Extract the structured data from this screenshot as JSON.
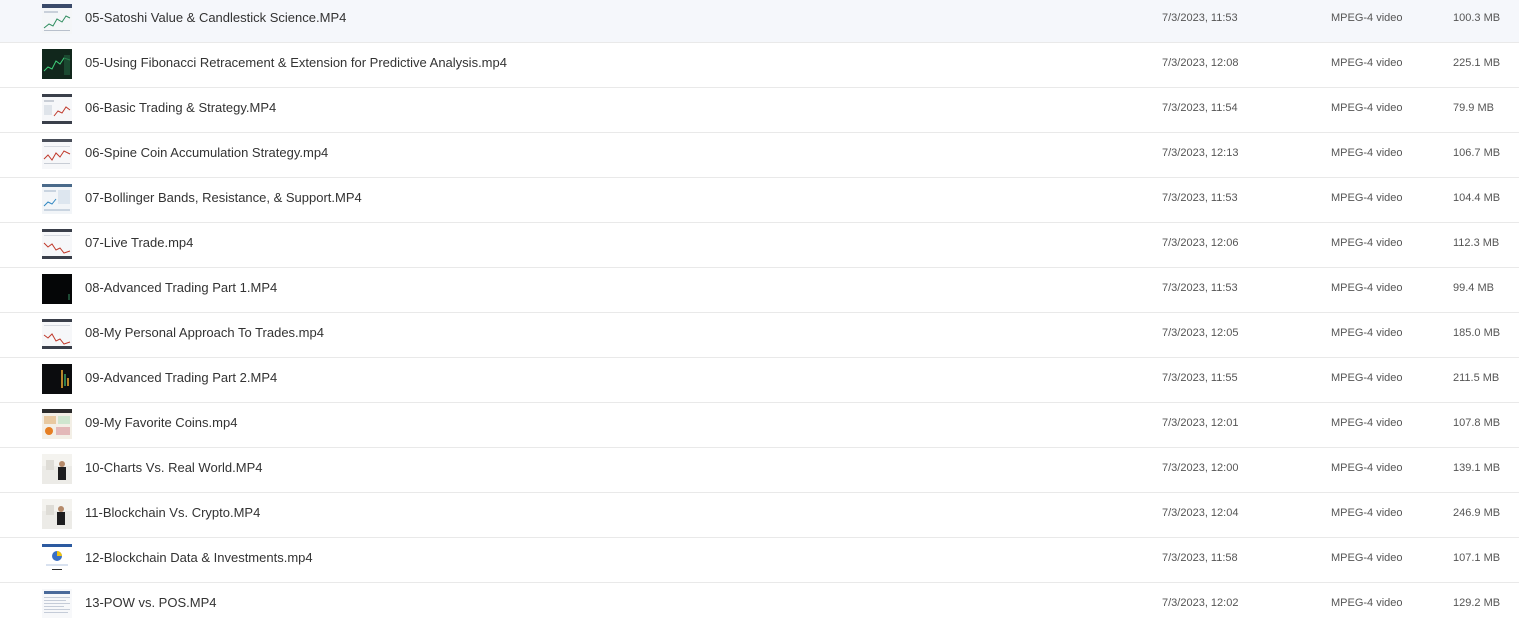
{
  "files": [
    {
      "name": "05-Satoshi Value & Candlestick Science.MP4",
      "modified": "7/3/2023, 11:53",
      "type": "MPEG-4 video",
      "size": "100.3 MB",
      "thumbnail": "chart-light-thumbnail-icon"
    },
    {
      "name": "05-Using Fibonacci Retracement & Extension for Predictive Analysis.mp4",
      "modified": "7/3/2023, 12:08",
      "type": "MPEG-4 video",
      "size": "225.1 MB",
      "thumbnail": "chart-dark-thumbnail-icon"
    },
    {
      "name": "06-Basic Trading & Strategy.MP4",
      "modified": "7/3/2023, 11:54",
      "type": "MPEG-4 video",
      "size": "79.9 MB",
      "thumbnail": "chart-light-thumbnail-icon"
    },
    {
      "name": "06-Spine Coin Accumulation Strategy.mp4",
      "modified": "7/3/2023, 12:13",
      "type": "MPEG-4 video",
      "size": "106.7 MB",
      "thumbnail": "chart-light-thumbnail-icon"
    },
    {
      "name": "07-Bollinger Bands, Resistance, & Support.MP4",
      "modified": "7/3/2023, 11:53",
      "type": "MPEG-4 video",
      "size": "104.4 MB",
      "thumbnail": "chart-light-thumbnail-icon"
    },
    {
      "name": "07-Live Trade.mp4",
      "modified": "7/3/2023, 12:06",
      "type": "MPEG-4 video",
      "size": "112.3 MB",
      "thumbnail": "chart-light-thumbnail-icon"
    },
    {
      "name": "08-Advanced Trading Part 1.MP4",
      "modified": "7/3/2023, 11:53",
      "type": "MPEG-4 video",
      "size": "99.4 MB",
      "thumbnail": "chart-black-thumbnail-icon"
    },
    {
      "name": "08-My Personal Approach To Trades.mp4",
      "modified": "7/3/2023, 12:05",
      "type": "MPEG-4 video",
      "size": "185.0 MB",
      "thumbnail": "chart-light-thumbnail-icon"
    },
    {
      "name": "09-Advanced Trading Part 2.MP4",
      "modified": "7/3/2023, 11:55",
      "type": "MPEG-4 video",
      "size": "211.5 MB",
      "thumbnail": "chart-dark-thumbnail-icon"
    },
    {
      "name": "09-My Favorite Coins.mp4",
      "modified": "7/3/2023, 12:01",
      "type": "MPEG-4 video",
      "size": "107.8 MB",
      "thumbnail": "coins-thumbnail-icon"
    },
    {
      "name": "10-Charts Vs. Real World.MP4",
      "modified": "7/3/2023, 12:00",
      "type": "MPEG-4 video",
      "size": "139.1 MB",
      "thumbnail": "presenter-thumbnail-icon"
    },
    {
      "name": "11-Blockchain Vs. Crypto.MP4",
      "modified": "7/3/2023, 12:04",
      "type": "MPEG-4 video",
      "size": "246.9 MB",
      "thumbnail": "presenter-thumbnail-icon"
    },
    {
      "name": "12-Blockchain Data & Investments.mp4",
      "modified": "7/3/2023, 11:58",
      "type": "MPEG-4 video",
      "size": "107.1 MB",
      "thumbnail": "dashboard-thumbnail-icon"
    },
    {
      "name": "13-POW vs. POS.MP4",
      "modified": "7/3/2023, 12:02",
      "type": "MPEG-4 video",
      "size": "129.2 MB",
      "thumbnail": "document-thumbnail-icon"
    }
  ]
}
